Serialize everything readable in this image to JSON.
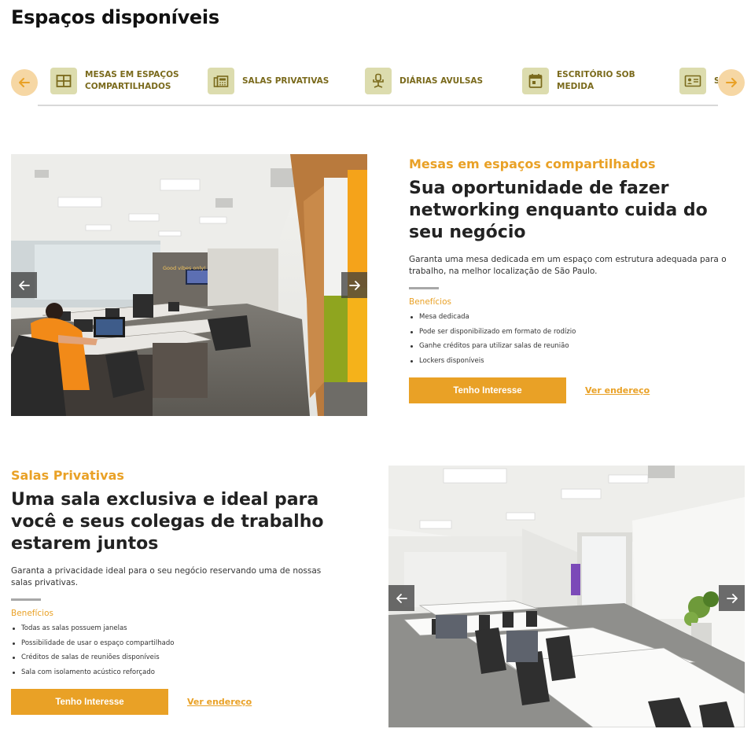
{
  "page": {
    "title": "Espaços disponíveis"
  },
  "categories": [
    {
      "label": "Mesas em espaços compartilhados",
      "icon": "table-grid-icon"
    },
    {
      "label": "Salas privativas",
      "icon": "fax-machine-icon"
    },
    {
      "label": "Diárias avulsas",
      "icon": "office-chair-icon"
    },
    {
      "label": "Escritório sob medida",
      "icon": "calendar-icon"
    },
    {
      "label": "S",
      "icon": "id-card-icon"
    }
  ],
  "colors": {
    "accent": "#e9a126",
    "category_icon_bg": "#dcdcae",
    "category_text": "#7a6a1c",
    "arrow_bg": "#f6d7a4"
  },
  "cards": [
    {
      "eyebrow": "Mesas em espaços compartilhados",
      "headline": "Sua oportunidade de fazer networking enquanto cuida do seu negócio",
      "description": "Garanta uma mesa dedicada em um espaço com estrutura adequada para o trabalho, na melhor localização de São Paulo.",
      "benefits_title": "Benefícios",
      "benefits": [
        "Mesa dedicada",
        "Pode ser disponibilizado em formato de rodízio",
        "Ganhe créditos para utilizar salas de reunião",
        "Lockers disponíveis"
      ],
      "cta": "Tenho Interesse",
      "link": "Ver endereço",
      "photo_sign": "Good vibes only!"
    },
    {
      "eyebrow": "Salas Privativas",
      "headline": "Uma sala exclusiva e ideal para você e seus colegas de trabalho estarem juntos",
      "description": "Garanta a privacidade ideal para o seu negócio reservando uma de nossas salas privativas.",
      "benefits_title": "Benefícios",
      "benefits": [
        "Todas as salas possuem janelas",
        "Possibilidade de usar o espaço compartilhado",
        "Créditos de salas de reuniões disponíveis",
        "Sala com isolamento acústico reforçado"
      ],
      "cta": "Tenho Interesse",
      "link": "Ver endereço"
    }
  ]
}
